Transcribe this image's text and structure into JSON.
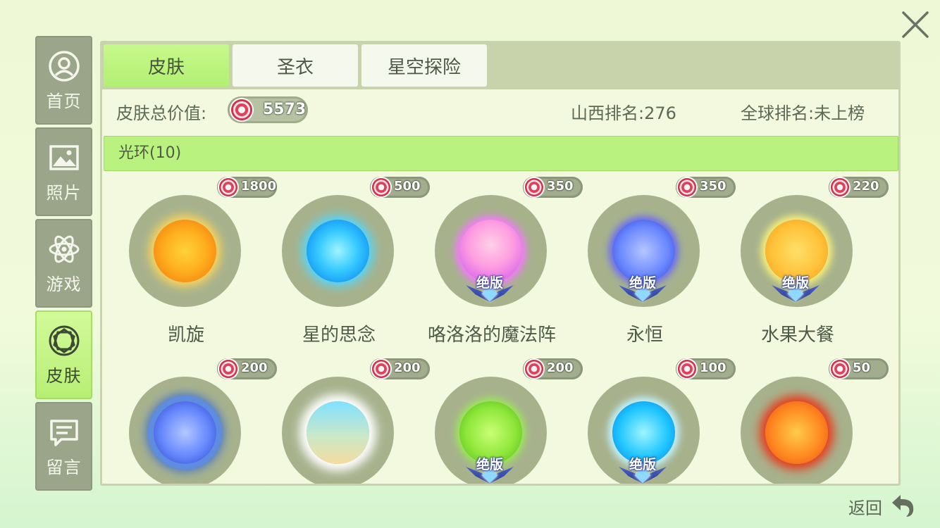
{
  "sidebar": {
    "items": [
      {
        "label": "首页",
        "icon": "profile-icon"
      },
      {
        "label": "照片",
        "icon": "image-icon"
      },
      {
        "label": "游戏",
        "icon": "atom-icon"
      },
      {
        "label": "皮肤",
        "icon": "gem-outline-icon",
        "active": true
      },
      {
        "label": "留言",
        "icon": "message-icon"
      }
    ]
  },
  "tabs": [
    {
      "label": "皮肤",
      "active": true
    },
    {
      "label": "圣衣",
      "active": false
    },
    {
      "label": "星空探险",
      "active": false
    }
  ],
  "stats": {
    "total_label": "皮肤总价值:",
    "total_value": "5573",
    "region_rank": "山西排名:276",
    "global_rank": "全球排名:未上榜"
  },
  "category": {
    "label": "光环(10)"
  },
  "items": [
    {
      "name": "凯旋",
      "price": "1800",
      "limited": false,
      "badge": ""
    },
    {
      "name": "星的思念",
      "price": "500",
      "limited": false,
      "badge": ""
    },
    {
      "name": "咯洛洛的魔法阵",
      "price": "350",
      "limited": true,
      "badge": "绝版"
    },
    {
      "name": "永恒",
      "price": "350",
      "limited": true,
      "badge": "绝版"
    },
    {
      "name": "水果大餐",
      "price": "220",
      "limited": true,
      "badge": "绝版"
    },
    {
      "name": "",
      "price": "200",
      "limited": false,
      "badge": ""
    },
    {
      "name": "",
      "price": "200",
      "limited": false,
      "badge": ""
    },
    {
      "name": "",
      "price": "200",
      "limited": true,
      "badge": "绝版"
    },
    {
      "name": "",
      "price": "100",
      "limited": true,
      "badge": "绝版"
    },
    {
      "name": "",
      "price": "50",
      "limited": false,
      "badge": ""
    }
  ],
  "back": {
    "label": "返回"
  },
  "colors": {
    "accent": "#b8ee74",
    "disc": "#a7b28d",
    "badge": "#2b3c8f"
  }
}
